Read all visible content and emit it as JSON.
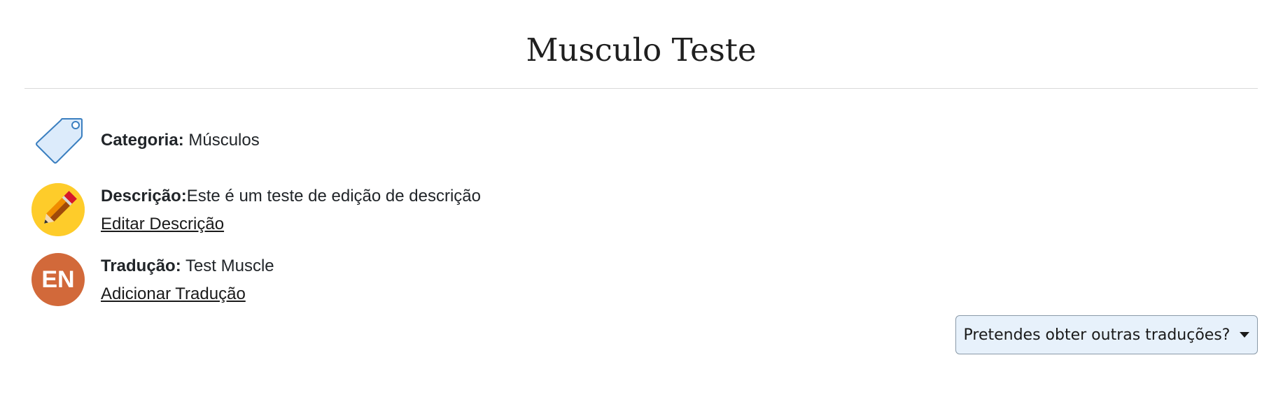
{
  "page": {
    "title": "Musculo Teste"
  },
  "category": {
    "label": "Categoria:",
    "value": " Músculos",
    "icon": "tag-icon"
  },
  "description": {
    "label": "Descrição:",
    "value": "Este é um teste de edição de descrição",
    "edit_link": "Editar Descrição",
    "icon": "pencil-icon"
  },
  "translation": {
    "label": "Tradução:",
    "value": " Test Muscle",
    "add_link": "Adicionar Tradução",
    "language_badge": "EN",
    "badge_color": "#d2693a"
  },
  "other_translations": {
    "button_label": "Pretendes obter outras traduções?",
    "icon": "caret-down-icon"
  }
}
